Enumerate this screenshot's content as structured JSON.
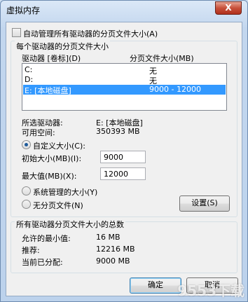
{
  "window": {
    "title": "虚拟内存",
    "close_label": "X"
  },
  "auto_manage": {
    "label": "自动管理所有驱动器的分页文件大小(A)",
    "checked": false
  },
  "per_drive": {
    "group_label": "每个驱动器的分页文件大小",
    "columns": {
      "drive": "驱动器 [卷标](D)",
      "size": "分页文件大小(MB)"
    },
    "rows": [
      {
        "drive": "C:",
        "size": "无",
        "selected": false
      },
      {
        "drive": "D:",
        "size": "无",
        "selected": false
      },
      {
        "drive": "E:   [本地磁盘]",
        "size": "9000 - 12000",
        "selected": true
      }
    ],
    "selected_drive_label": "所选驱动器:",
    "selected_drive_value": "E:  [本地磁盘]",
    "free_space_label": "可用空间:",
    "free_space_value": "350393 MB"
  },
  "size_options": {
    "custom_label": "自定义大小(C):",
    "initial_label": "初始大小(MB)(I):",
    "initial_value": "9000",
    "max_label": "最大值(MB)(X):",
    "max_value": "12000",
    "system_managed_label": "系统管理的大小(Y)",
    "no_paging_label": "无分页文件(N)",
    "selected": "custom",
    "set_button": "设置(S)"
  },
  "totals": {
    "group_label": "所有驱动器分页文件大小的总数",
    "min_label": "允许的最小值:",
    "min_value": "16 MB",
    "recommended_label": "推荐:",
    "recommended_value": "12216 MB",
    "current_label": "当前已分配:",
    "current_value": "9000 MB"
  },
  "buttons": {
    "ok": "确定",
    "cancel": "取消"
  },
  "watermark": "9553下载"
}
